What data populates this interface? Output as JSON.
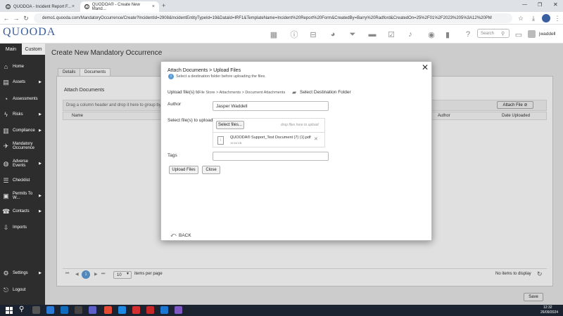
{
  "browser": {
    "tabs": [
      {
        "label": "QUODOA - Incident Report F...",
        "active": false
      },
      {
        "label": "QUODOA® - Create New Mand...",
        "active": true
      }
    ],
    "url": "demo1.quooda.com/MandatoryOccurrence/Create?IncidentId=2908&IncidentEntityTypeId=19&DataId=IRF1&TemplateName=Incident%20Report%20Form&CreatedBy=Barry%20Radford&CreatedOn=25%2F01%2F2023%205%3A12%20PM"
  },
  "header": {
    "logo": "QUOODA",
    "search_placeholder": "Search",
    "username": "jwaddell"
  },
  "sidebar": {
    "tab_main": "Main",
    "tab_custom": "Custom",
    "items": [
      {
        "label": "Home",
        "icon": "home-icon",
        "arrow": false
      },
      {
        "label": "Assets",
        "icon": "briefcase-icon",
        "arrow": true
      },
      {
        "label": "Assessments",
        "icon": "gauge-icon",
        "arrow": false
      },
      {
        "label": "Risks",
        "icon": "bolt-icon",
        "arrow": true
      },
      {
        "label": "Compliance",
        "icon": "bar-chart-icon",
        "arrow": true
      },
      {
        "label": "Mandatory Occurrence",
        "icon": "plane-icon",
        "arrow": false
      },
      {
        "label": "Adverse Events",
        "icon": "globe-icon",
        "arrow": true
      },
      {
        "label": "Checklist",
        "icon": "checklist-icon",
        "arrow": false
      },
      {
        "label": "Permits To W...",
        "icon": "permit-icon",
        "arrow": true
      },
      {
        "label": "Contacts",
        "icon": "contacts-icon",
        "arrow": true
      },
      {
        "label": "Imports",
        "icon": "import-icon",
        "arrow": false
      }
    ],
    "settings": "Settings",
    "logout": "Logout"
  },
  "page": {
    "title": "Create New Mandatory Occurrence",
    "tabs": [
      "Details",
      "Documents"
    ],
    "section_title": "Attach Documents",
    "group_hint": "Drag a column header and drop it here to group by t",
    "attach_file": "Attach File",
    "columns": [
      "Name",
      "Author",
      "Date Uploaded"
    ],
    "page_size": "10",
    "items_per_page": "items per page",
    "no_items": "No items to display",
    "current_page": "1",
    "save": "Save"
  },
  "modal": {
    "title": "Attach Documents > Upload Files",
    "info": "Select a destination folder before uploading the files.",
    "upload_to_label": "Upload file(s) to",
    "upload_path": "File Store > Attachments > Document Attachments",
    "select_folder": "Select Destination Folder",
    "author_label": "Author",
    "author_value": "Jasper Waddell",
    "select_label": "Select file(s) to upload",
    "select_files_btn": "Select files...",
    "drop_hint": "drop files here to upload",
    "file_name": "QUOODA® Support_Test Document (7) (1).pdf",
    "file_size": "19.54 KB",
    "tags_label": "Tags",
    "tags_value": "",
    "upload_btn": "Upload Files",
    "close_btn": "Close",
    "back": "BACK"
  },
  "taskbar": {
    "time": "12:32",
    "date": "26/09/2024"
  },
  "colors": {
    "sidebar": "#2d2d2d",
    "accent_blue": "#3a5fa0",
    "taskbar": "#1c2330"
  }
}
